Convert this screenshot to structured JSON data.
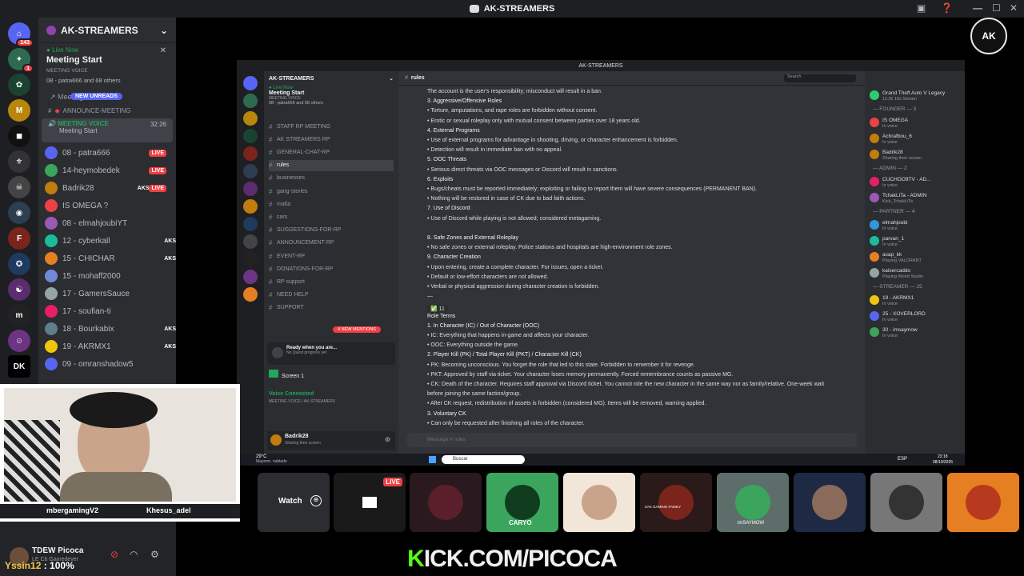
{
  "title_bar": {
    "title": "AK-STREAMERS"
  },
  "servers": {
    "home_badge": "143",
    "badge_1": "1"
  },
  "sidebar": {
    "server_name": "AK-STREAMERS",
    "live_now": "Live Now",
    "meeting_title": "Meeting Start",
    "voice_label": "MEETING VOICE",
    "listeners": "08 - patra666 and 68 others",
    "meeting_link": "Meeting",
    "new_unreads": "NEW UNREADS",
    "announce": "ANNOUNCE-MEETING",
    "meeting_voice": "MEETING VOICE",
    "timer": "32:26",
    "meeting_start": "Meeting Start",
    "members": [
      {
        "name": "08 - patra666",
        "tag": "LIVE",
        "color": "#5865f2"
      },
      {
        "name": "14-heymobedek",
        "tag": "LIVE",
        "color": "#3ba55d"
      },
      {
        "name": "Badrik28",
        "tag": "AKS",
        "tag2": "LIVE",
        "color": "#c27c0e"
      },
      {
        "name": "IS OMEGA ?",
        "tag": "",
        "color": "#ed4245"
      },
      {
        "name": "08 - elmahjoubiYT",
        "tag": "",
        "color": "#9b59b6"
      },
      {
        "name": "12 - cyberkall",
        "tag": "AKS",
        "color": "#1abc9c"
      },
      {
        "name": "15 - CHICHAR",
        "tag": "AKS",
        "color": "#e67e22"
      },
      {
        "name": "15 - mohaff2000",
        "tag": "",
        "color": "#7289da"
      },
      {
        "name": "17 - GamersSauce",
        "tag": "",
        "color": "#95a5a6"
      },
      {
        "name": "17 - soufian-ti",
        "tag": "",
        "color": "#e91e63"
      },
      {
        "name": "18 - Bourkabix",
        "tag": "AKS",
        "color": "#607d8b"
      },
      {
        "name": "19 - AKRMX1",
        "tag": "AKS",
        "color": "#f1c40f"
      },
      {
        "name": "09 - omranshadow5",
        "tag": "",
        "color": "#5865f2"
      }
    ]
  },
  "inner": {
    "title": "AK-STREAMERS",
    "server_name": "AK-STREAMERS",
    "meeting": "Meeting Start",
    "voice": "MEETING VOICE",
    "listeners": "08 - patra666 and 68 others",
    "channels": [
      "STAFF RP MEETING",
      "AK STREAMERS RP",
      "GENERAL-CHAT-RP",
      "rules",
      "businesses",
      "gang-stories",
      "mafia",
      "cars",
      "SUGGESTIONS-FOR-RP",
      "ANNOUNCEMENT-RP",
      "EVENT-RP",
      "DONATIONS-FOR-RP",
      "RP support",
      "NEED HELP",
      "SUPPORT"
    ],
    "new_mentions": "4 NEW MENTIONS",
    "quest_title": "Ready when you are...",
    "quest_sub": "No Quest progress yet",
    "screen": "Screen 1",
    "voice_connected": "Voice Connected",
    "voice_channel": "MEETING VOICE / AK-STREAMERS",
    "user": "Badrik28",
    "user_status": "Sharing their screen",
    "channel": "rules",
    "search_placeholder": "Search",
    "message_placeholder": "Message # rules",
    "messages": [
      "The account is the user's responsibility; misconduct will result in a ban.",
      "3. Aggressive/Offensive Roles",
      "•  Torture, amputations, and rape roles are forbidden without consent.",
      "•  Erotic or sexual roleplay only with mutual consent between parties over 18 years old.",
      "4. External Programs",
      "•  Use of external programs for advantage in shooting, driving, or character enhancement is forbidden.",
      "•  Detection will result in immediate ban with no appeal.",
      "5. OOC Threats",
      "•  Serious direct threats via OOC messages or Discord will result in sanctions.",
      "6. Exploits",
      "•  Bugs/cheats must be reported immediately; exploiting or failing to report them will have severe consequences (PERMANENT BAN).",
      "•  Nothing will be restored in case of CK due to bad faith actions.",
      "7. Use of Discord",
      "•  Use of Discord while playing is not allowed; considered metagaming.",
      "",
      "8. Safe Zones and External Roleplay",
      "•  No safe zones or external roleplay. Police stations and hospitals are high-environment role zones.",
      "9. Character Creation",
      "•  Upon entering, create a complete character. For issues, open a ticket.",
      "•  Default or low-effort characters are not allowed.",
      "•  Verbal or physical aggression during character creation is forbidden.",
      "—",
      "",
      "Role Terms",
      "1. In Character (IC) / Out of Character (OOC)",
      "•  IC: Everything that happens in-game and affects your character.",
      "•  OOC: Everything outside the game.",
      "2. Player Kill (PK) / Total Player Kill (PKT) / Character Kill (CK)",
      "•  PK: Becoming unconscious. You forget the role that led to this state. Forbidden to remember it for revenge.",
      "•  PKT: Approved by staff via ticket. Your character loses memory permanently. Forced remembrance counts as passive MG.",
      "•  CK: Death of the character. Requires staff approval via Discord ticket. You cannot role the new character in the same way nor as family/relative. One-week wait",
      "before joining the same faction/group.",
      "•  After CK request, redistribution of assets is forbidden (considered MG). Items will be removed, warning applied.",
      "3. Voluntary CK",
      "•  Can only be requested after finishing all roles of the character."
    ],
    "reaction_count": "11",
    "members": [
      {
        "name": "Grand Theft Auto V Legacy",
        "status": "11:26  10s Stream",
        "color": "#2ecc71"
      },
      {
        "name": "— FOUNDER — 3",
        "status": "",
        "color": ""
      },
      {
        "name": "IS OMEGA",
        "status": "In voice",
        "color": "#ed4245"
      },
      {
        "name": "Achrafbou_6",
        "status": "In voice",
        "color": "#c27c0e"
      },
      {
        "name": "Badrik28",
        "status": "Sharing their screen",
        "color": "#c27c0e"
      },
      {
        "name": "— ADMIN — 2",
        "status": "",
        "color": ""
      },
      {
        "name": "CUCHOO9TV - AD...",
        "status": "In voice",
        "color": "#e91e63"
      },
      {
        "name": "TchakLiTa - ADMIN",
        "status": "Kick_TchakLiTa",
        "color": "#9b59b6"
      },
      {
        "name": "— PARTNER — 4",
        "status": "",
        "color": ""
      },
      {
        "name": "elmahjoubi",
        "status": "In voice",
        "color": "#3498db"
      },
      {
        "name": "parvan_1",
        "status": "In voice",
        "color": "#1abc9c"
      },
      {
        "name": "asap_kk",
        "status": "Playing VALORANT",
        "color": "#e67e22"
      },
      {
        "name": "kaisercaddo",
        "status": "Playing World Studio",
        "color": "#95a5a6"
      },
      {
        "name": "— STREAMER — 25",
        "status": "",
        "color": ""
      },
      {
        "name": "19 - AKRMX1",
        "status": "In voice",
        "color": "#f1c40f"
      },
      {
        "name": "25 - XOVERLORD",
        "status": "In voice",
        "color": "#5865f2"
      },
      {
        "name": "30 - imsaymow",
        "status": "In voice",
        "color": "#3ba55d"
      }
    ],
    "task_weather": "29°C",
    "task_weather_sub": "Mayorm. nublado",
    "task_search": "Buscar",
    "task_lang": "ESP",
    "task_time": "23:18",
    "task_date": "08/10/2025"
  },
  "webcam": {
    "left_name": "mbergamingV2",
    "right_name": "Khesus_adel"
  },
  "tiles": {
    "watch": "Watch",
    "live": "LIVE",
    "caryo": "CARYO",
    "zak": "ZAK GAMING FAMILY",
    "imsay": "imSAYMOW"
  },
  "user_panel": {
    "name": "TDEW Picoca",
    "status": "LE Cb Gamedever"
  },
  "overlay": {
    "kick_k": "K",
    "kick_rest": "ICK.COM/PICOCA",
    "yssin": "Yssin12",
    "percent": ": 100%"
  },
  "logo": {
    "text": "AK"
  },
  "colors": {
    "discord_dark": "#1e1f22",
    "discord_mid": "#2b2d31",
    "discord_bg": "#313338",
    "live_red": "#f23f43",
    "kick_green": "#53fc18"
  }
}
